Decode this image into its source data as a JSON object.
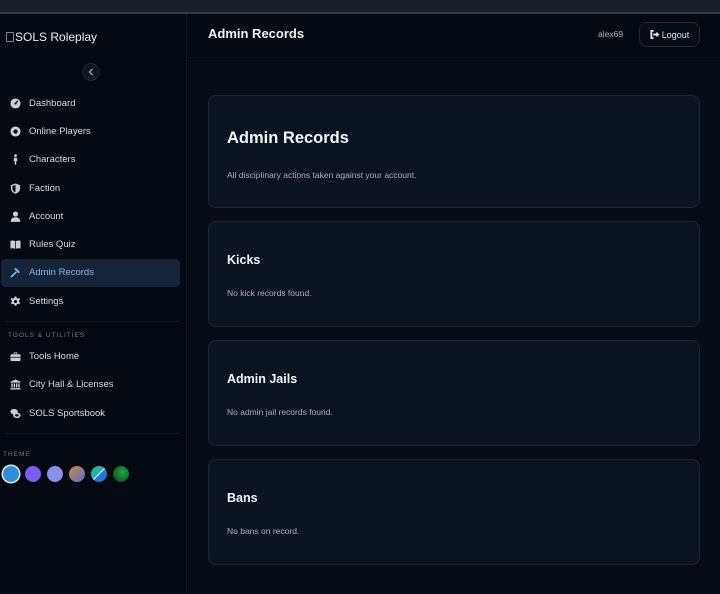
{
  "app": {
    "logo_alt": "SOLS Roleplay"
  },
  "sidebar": {
    "items": [
      {
        "label": "Dashboard",
        "icon": "gauge-icon"
      },
      {
        "label": "Online Players",
        "icon": "record-icon"
      },
      {
        "label": "Characters",
        "icon": "person-walking-icon"
      },
      {
        "label": "Faction",
        "icon": "shield-icon"
      },
      {
        "label": "Account",
        "icon": "user-icon"
      },
      {
        "label": "Rules Quiz",
        "icon": "book-icon"
      },
      {
        "label": "Admin Records",
        "icon": "gavel-icon",
        "active": true
      },
      {
        "label": "Settings",
        "icon": "gear-icon"
      }
    ],
    "tools_title": "TOOLS & UTILITIES",
    "tools": [
      {
        "label": "Tools Home",
        "icon": "toolbox-icon"
      },
      {
        "label": "City Hall & Licenses",
        "icon": "landmark-icon"
      },
      {
        "label": "SOLS Sportsbook",
        "icon": "coins-icon"
      }
    ],
    "theme_title": "THEME",
    "themes": [
      "#2d8ed9",
      "#7a5cf0",
      "#8a8ff0",
      "gradient-sunset",
      "gradient-teal",
      "gradient-green"
    ]
  },
  "header": {
    "title": "Admin Records",
    "username": "alex69",
    "logout_label": "Logout"
  },
  "main": {
    "intro": {
      "title": "Admin Records",
      "subtitle": "All disciplinary actions taken against your account."
    },
    "kicks": {
      "title": "Kicks",
      "empty": "No kick records found."
    },
    "jails": {
      "title": "Admin Jails",
      "empty": "No admin jail records found."
    },
    "bans": {
      "title": "Bans",
      "empty": "No bans on record."
    }
  }
}
